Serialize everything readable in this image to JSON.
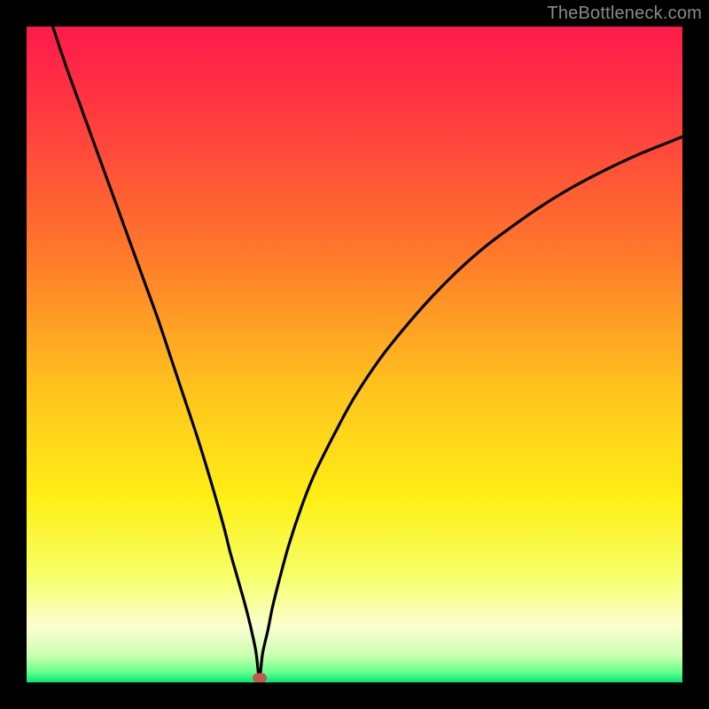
{
  "watermark": "TheBottleneck.com",
  "marker": {
    "color": "#c1594f",
    "x_percent": 35.5,
    "y_percent": 100
  },
  "gradient_stops": [
    {
      "offset": 0,
      "color": "#ff1a4b"
    },
    {
      "offset": 0.15,
      "color": "#ff3e3e"
    },
    {
      "offset": 0.35,
      "color": "#ff7a2a"
    },
    {
      "offset": 0.55,
      "color": "#ffc21e"
    },
    {
      "offset": 0.72,
      "color": "#ffef15"
    },
    {
      "offset": 0.84,
      "color": "#f6ff6a"
    },
    {
      "offset": 0.915,
      "color": "#fbffd0"
    },
    {
      "offset": 0.96,
      "color": "#c9ffb0"
    },
    {
      "offset": 0.985,
      "color": "#62ff8a"
    },
    {
      "offset": 1.0,
      "color": "#00e676"
    }
  ],
  "chart_data": {
    "type": "line",
    "title": "",
    "xlabel": "",
    "ylabel": "",
    "xlim": [
      0,
      100
    ],
    "ylim": [
      0,
      100
    ],
    "grid": false,
    "legend": false,
    "series": [
      {
        "name": "bottleneck-curve",
        "x": [
          4,
          6,
          8,
          10,
          12,
          14,
          16,
          18,
          20,
          22,
          24,
          26,
          28,
          30,
          31,
          32,
          33,
          33.8,
          34.5,
          35,
          35.5,
          36,
          36.8,
          37.5,
          38.5,
          40,
          42,
          44,
          47,
          50,
          54,
          58,
          62,
          66,
          70,
          74,
          78,
          82,
          86,
          90,
          94,
          98,
          100
        ],
        "y": [
          100,
          94,
          88.5,
          83,
          77.5,
          72,
          66.5,
          61,
          55.5,
          49.5,
          43.5,
          37.5,
          31,
          24,
          20,
          16.5,
          13,
          10,
          7,
          4.5,
          0.8,
          4.5,
          8,
          11.5,
          15.5,
          21,
          27,
          32,
          38,
          43.5,
          49.5,
          54.5,
          59,
          63,
          66.5,
          69.5,
          72.3,
          74.8,
          77,
          79,
          80.8,
          82.4,
          83.2
        ]
      }
    ],
    "markers": [
      {
        "name": "optimal-point",
        "x": 35.5,
        "y": 0.8,
        "color": "#c1594f"
      }
    ]
  }
}
